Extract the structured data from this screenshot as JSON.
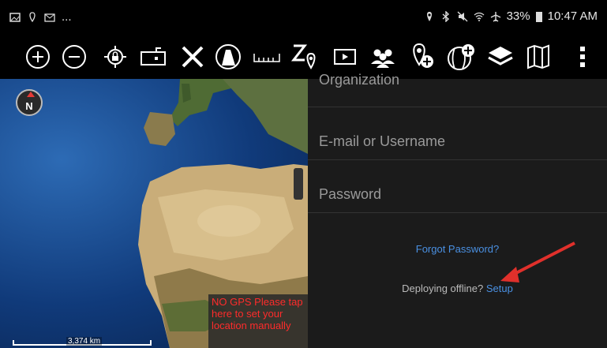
{
  "status_bar": {
    "left_more": "...",
    "battery": "33%",
    "time": "10:47 AM"
  },
  "toolbar": {
    "icons": [
      "zoom-in-icon",
      "zoom-out-icon",
      "locate-icon",
      "lock-rotation-icon",
      "close-icon",
      "track-up-icon",
      "ruler-icon",
      "zoom-location-icon",
      "video-icon",
      "team-icon",
      "add-marker-icon",
      "add-layer-icon",
      "layers-icon",
      "map-icon",
      "more-icon"
    ]
  },
  "map": {
    "compass_label": "N",
    "scale_label": "3,374 km",
    "nogps_text": "NO GPS Please tap here to set your location manually"
  },
  "login": {
    "organization_placeholder": "Organization",
    "username_placeholder": "E-mail or Username",
    "password_placeholder": "Password",
    "forgot_password": "Forgot Password?",
    "offline_prompt": "Deploying offline?",
    "setup_link": "Setup"
  },
  "colors": {
    "accent_link": "#4a90e2",
    "warning_red": "#ff2b2b",
    "annotation_arrow": "#e0302b"
  }
}
